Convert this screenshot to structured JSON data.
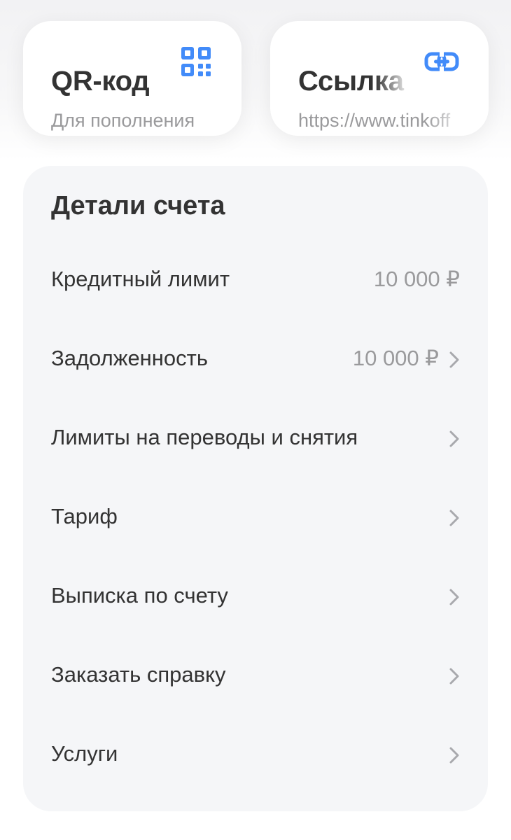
{
  "cards": {
    "qr": {
      "title": "QR-код",
      "subtitle": "Для пополнения",
      "icon": "qr-code-icon"
    },
    "link": {
      "title": "Ссылка",
      "subtitle": "https://www.tinkoff",
      "icon": "link-icon"
    }
  },
  "details": {
    "title": "Детали счета",
    "rows": [
      {
        "label": "Кредитный лимит",
        "value": "10 000 ₽",
        "arrow": false
      },
      {
        "label": "Задолженность",
        "value": "10 000 ₽",
        "arrow": true
      },
      {
        "label": "Лимиты на переводы и снятия",
        "value": "",
        "arrow": true
      },
      {
        "label": "Тариф",
        "value": "",
        "arrow": true
      },
      {
        "label": "Выписка по счету",
        "value": "",
        "arrow": true
      },
      {
        "label": "Заказать справку",
        "value": "",
        "arrow": true
      },
      {
        "label": "Услуги",
        "value": "",
        "arrow": true
      }
    ]
  },
  "colors": {
    "accent": "#428bf9",
    "text": "#333333",
    "muted": "#9a9a9c",
    "panel": "#f5f6f8"
  }
}
